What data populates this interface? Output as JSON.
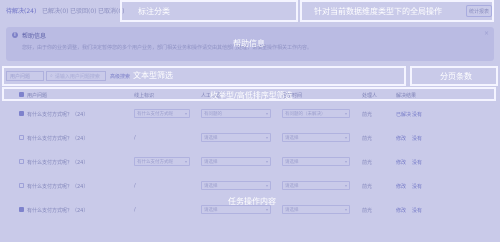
{
  "tabs": [
    "待解决(24)",
    "已解决(0)",
    "已驳回(0)",
    "已取消(0)"
  ],
  "stats_button": "统计报表",
  "help": {
    "title": "帮助信息",
    "text": "您好，由于你的业务调整，我们决定暂停您的多个用户业务，部门相关业务和操作请交由其他部门处理，请慎重操作相关工作内容。",
    "close": "×"
  },
  "filter": {
    "select": "用户问题",
    "placeholder": "请输入用户问题搜索",
    "advanced_link": "高级搜索"
  },
  "table": {
    "headers": [
      "用户问题",
      "线上标识",
      "人工处理",
      "回复时间",
      "处理人",
      "解决结果"
    ],
    "rows": [
      {
        "checked": true,
        "question": "有什么支付方式呢？（24）",
        "tag": "有什么支付方式呢",
        "handle": "有问题的",
        "reply": "有问题的（未解决）",
        "handler": "前光",
        "ops": [
          "已解决",
          "没有"
        ]
      },
      {
        "checked": false,
        "question": "有什么支付方式呢？（24）",
        "tag": "/",
        "handle": "请选择",
        "reply": "请选择",
        "handler": "前光",
        "ops": [
          "修改",
          "没有"
        ]
      },
      {
        "checked": false,
        "question": "有什么支付方式呢？（24）",
        "tag": "有什么支付方式呢",
        "handle": "请选择",
        "reply": "请选择",
        "handler": "前光",
        "ops": [
          "修改",
          "没有"
        ]
      },
      {
        "checked": false,
        "question": "有什么支付方式呢？（24）",
        "tag": "/",
        "handle": "请选择",
        "reply": "请选择",
        "handler": "前光",
        "ops": [
          "修改",
          "没有"
        ]
      },
      {
        "checked": true,
        "question": "有什么支付方式呢？（24）",
        "tag": "/",
        "handle": "请选择",
        "reply": "请选择",
        "handler": "前光",
        "ops": [
          "修改",
          "没有"
        ]
      }
    ]
  },
  "annotations": {
    "tag_category": "标注分类",
    "global_ops": "针对当前数据维度类型下的全局操作",
    "help_info": "帮助信息",
    "text_filter": "文本型筛选",
    "page_count": "分页条数",
    "sort_filter": "枚举型/高低排序型筛选",
    "task_content": "任务操作内容"
  }
}
